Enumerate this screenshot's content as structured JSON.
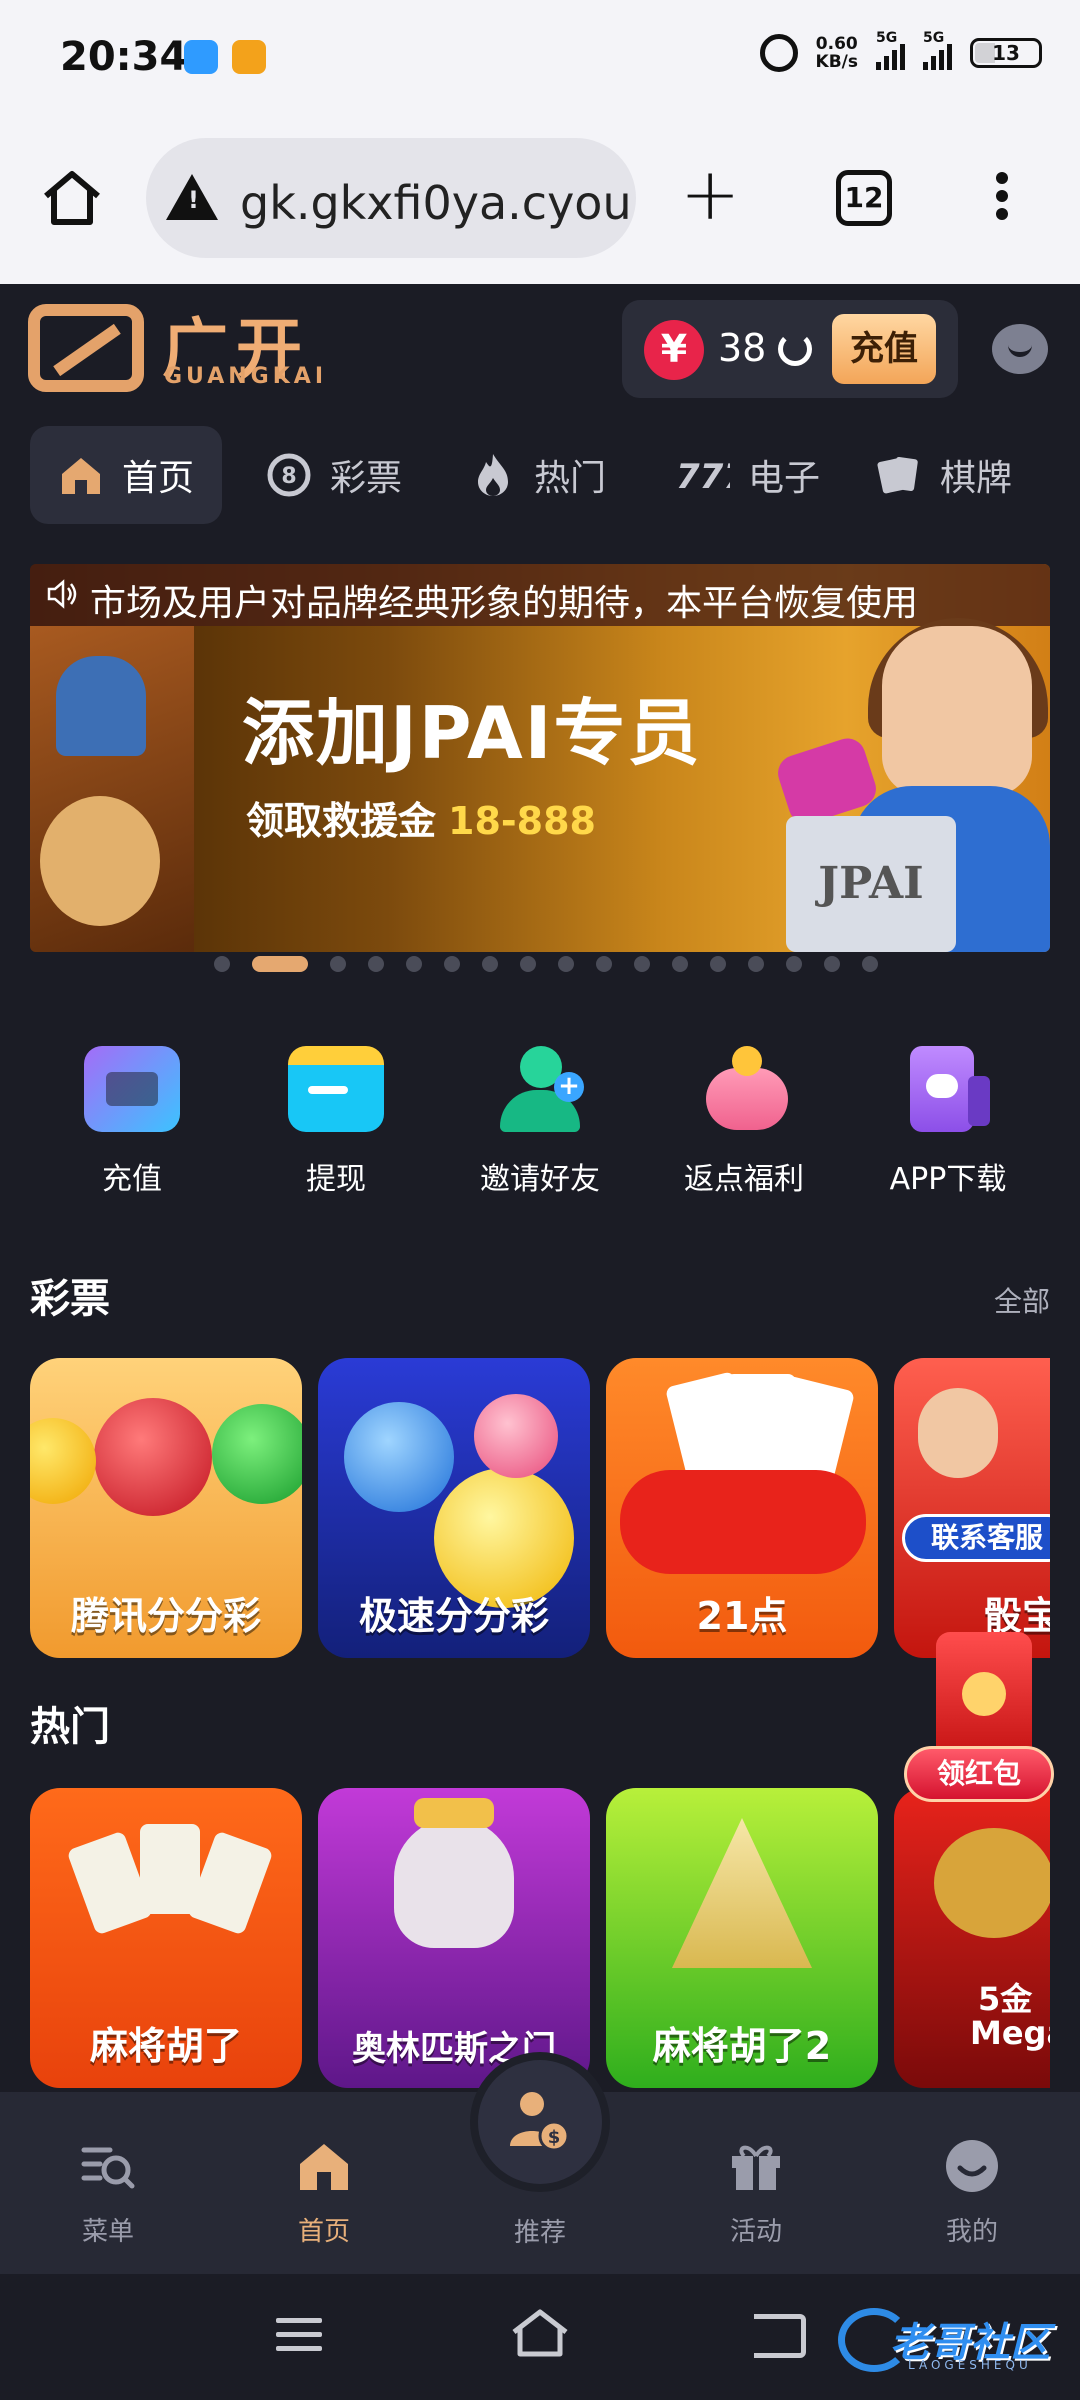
{
  "status_bar": {
    "time": "20:34",
    "net_speed_value": "0.60",
    "net_speed_unit": "KB/s",
    "sim1_label": "5G",
    "sim2_label": "5G",
    "battery": "13",
    "icons": [
      "app-notification-icon",
      "app-notification-icon",
      "alarm-icon",
      "signal-icon",
      "signal-icon",
      "battery-icon"
    ]
  },
  "browser": {
    "url": "gk.gkxfi0ya.cyou/",
    "tab_count": "12",
    "icons": [
      "home-icon",
      "warning-icon",
      "plus-icon",
      "tabs-icon",
      "more-vert-icon"
    ]
  },
  "header": {
    "logo_cn": "广开",
    "logo_en": "GUANGKAI",
    "currency_symbol": "¥",
    "balance": "38",
    "recharge_label": "充值",
    "icons": [
      "logo-icon",
      "yen-icon",
      "refresh-icon",
      "chat-icon"
    ]
  },
  "nav_tabs": [
    {
      "label": "首页",
      "icon": "home-icon",
      "active": true
    },
    {
      "label": "彩票",
      "icon": "lottery-ball-icon"
    },
    {
      "label": "热门",
      "icon": "flame-icon"
    },
    {
      "label": "电子",
      "icon": "slot-777-icon"
    },
    {
      "label": "棋牌",
      "icon": "cards-icon"
    }
  ],
  "banner": {
    "marquee": "市场及用户对品牌经典形象的期待，本平台恢复使用",
    "title": "添加JPAI专员",
    "subtitle": "领取救援金",
    "subtitle_amount": "18-888",
    "logo_text": "JPAI",
    "slide_count": 17,
    "active_slide": 2
  },
  "quick_actions": [
    {
      "label": "充值",
      "icon": "deposit-icon",
      "color": "#8b5cf6"
    },
    {
      "label": "提现",
      "icon": "wallet-icon",
      "color": "#22b8f0"
    },
    {
      "label": "邀请好友",
      "icon": "invite-friend-icon",
      "color": "#1fc28a"
    },
    {
      "label": "返点福利",
      "icon": "piggy-bank-icon",
      "color": "#ff7aa0"
    },
    {
      "label": "APP下载",
      "icon": "app-download-icon",
      "color": "#a86af0"
    }
  ],
  "lottery": {
    "title": "彩票",
    "all_label": "全部",
    "cards": [
      {
        "label": "腾讯分分彩",
        "theme": "orange"
      },
      {
        "label": "极速分分彩",
        "theme": "blue"
      },
      {
        "label": "21点",
        "theme": "red-orange"
      },
      {
        "label": "骰宝",
        "badge": "联系客服",
        "theme": "red"
      }
    ]
  },
  "hot": {
    "title": "热门",
    "cards": [
      {
        "label": "麻将胡了",
        "theme": "orange"
      },
      {
        "label": "奥林匹斯之门",
        "theme": "purple"
      },
      {
        "label": "麻将胡了2",
        "theme": "green"
      },
      {
        "label": "5金",
        "label2": "Megaw",
        "theme": "red"
      }
    ]
  },
  "red_packet": {
    "label": "领红包"
  },
  "bottom_nav": [
    {
      "label": "菜单",
      "icon": "menu-search-icon"
    },
    {
      "label": "首页",
      "icon": "home-icon",
      "active": true
    },
    {
      "label": "推荐",
      "icon": "referral-icon"
    },
    {
      "label": "活动",
      "icon": "gift-icon"
    },
    {
      "label": "我的",
      "icon": "profile-icon"
    }
  ],
  "watermark": {
    "text": "老哥社区",
    "sub": "LAOGESHEQU"
  },
  "colors": {
    "accent": "#e5a870",
    "background": "#1b1c25",
    "yen_badge": "#e8244a"
  }
}
